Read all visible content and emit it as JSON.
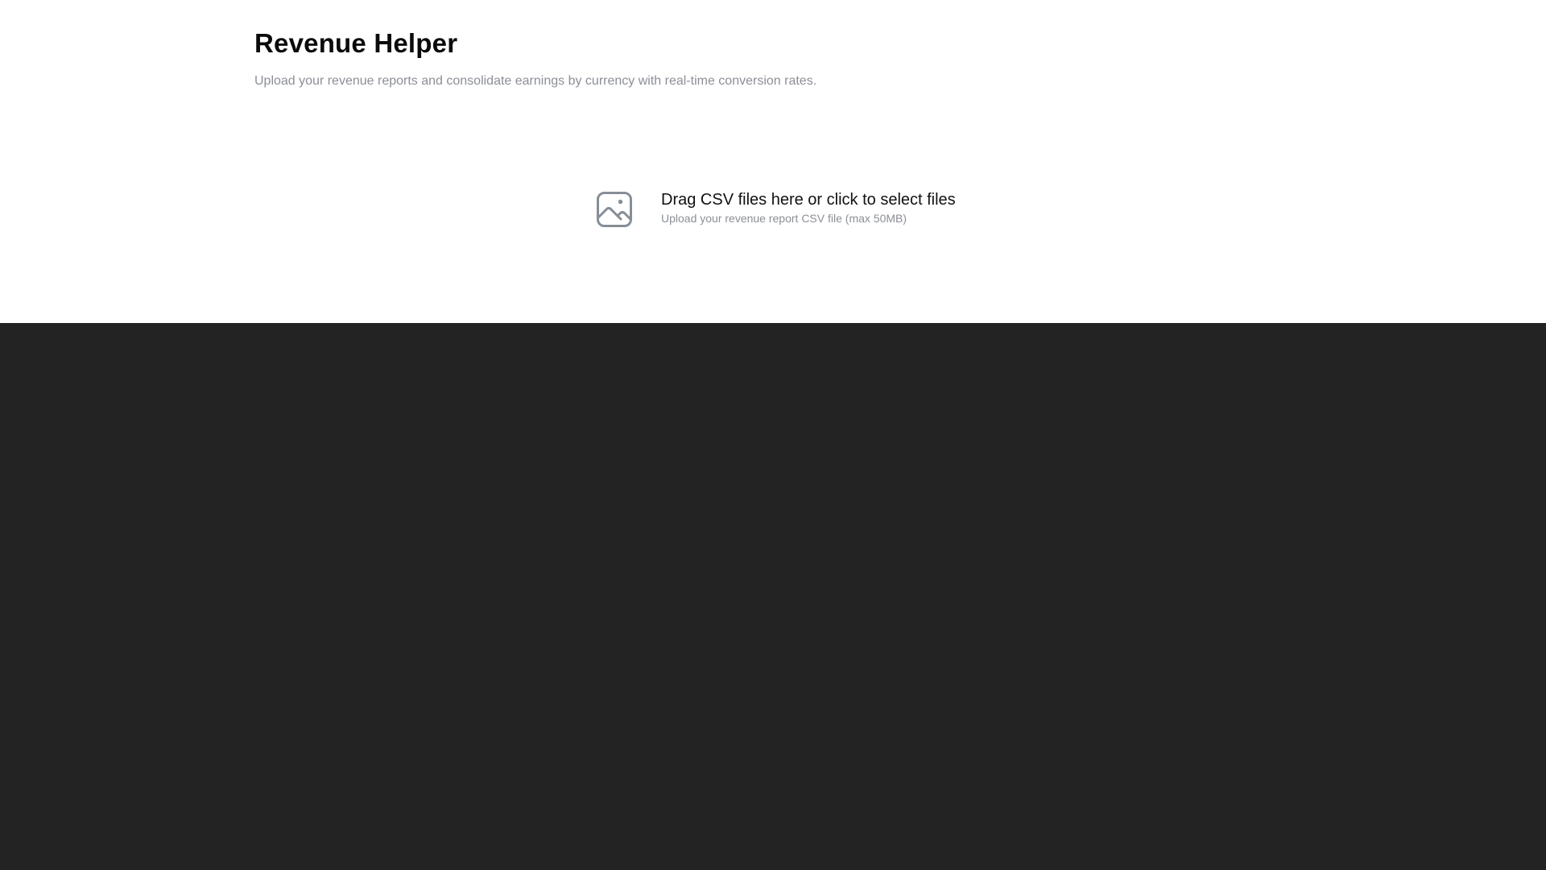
{
  "header": {
    "title": "Revenue Helper",
    "subtitle": "Upload your revenue reports and consolidate earnings by currency with real-time conversion rates."
  },
  "upload": {
    "icon": "image-icon",
    "title": "Drag CSV files here or click to select files",
    "hint": "Upload your revenue report CSV file (max 50MB)"
  },
  "colors": {
    "background_top": "#ffffff",
    "background_bottom": "#232323",
    "title_text": "#0b0b0b",
    "muted_text": "#8b8f96",
    "icon_stroke": "#868e96"
  }
}
